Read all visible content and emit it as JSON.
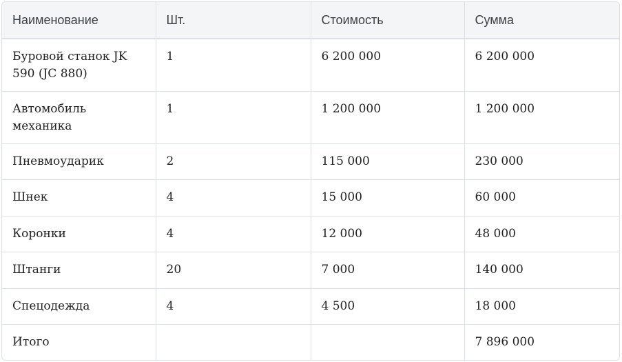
{
  "table": {
    "headers": [
      "Наименование",
      "Шт.",
      "Стоимость",
      "Сумма"
    ],
    "rows": [
      [
        "Буровой станок JK 590 (JC 880)",
        "1",
        "6 200 000",
        "6 200 000"
      ],
      [
        "Автомобиль механика",
        "1",
        "1 200 000",
        "1 200 000"
      ],
      [
        "Пневмоударик",
        "2",
        "115 000",
        "230 000"
      ],
      [
        "Шнек",
        "4",
        "15 000",
        "60 000"
      ],
      [
        "Коронки",
        "4",
        "12 000",
        "48 000"
      ],
      [
        "Штанги",
        "20",
        "7 000",
        "140 000"
      ],
      [
        "Спецодежда",
        "4",
        "4 500",
        "18 000"
      ],
      [
        "Итого",
        "",
        "",
        "7 896 000"
      ]
    ]
  }
}
